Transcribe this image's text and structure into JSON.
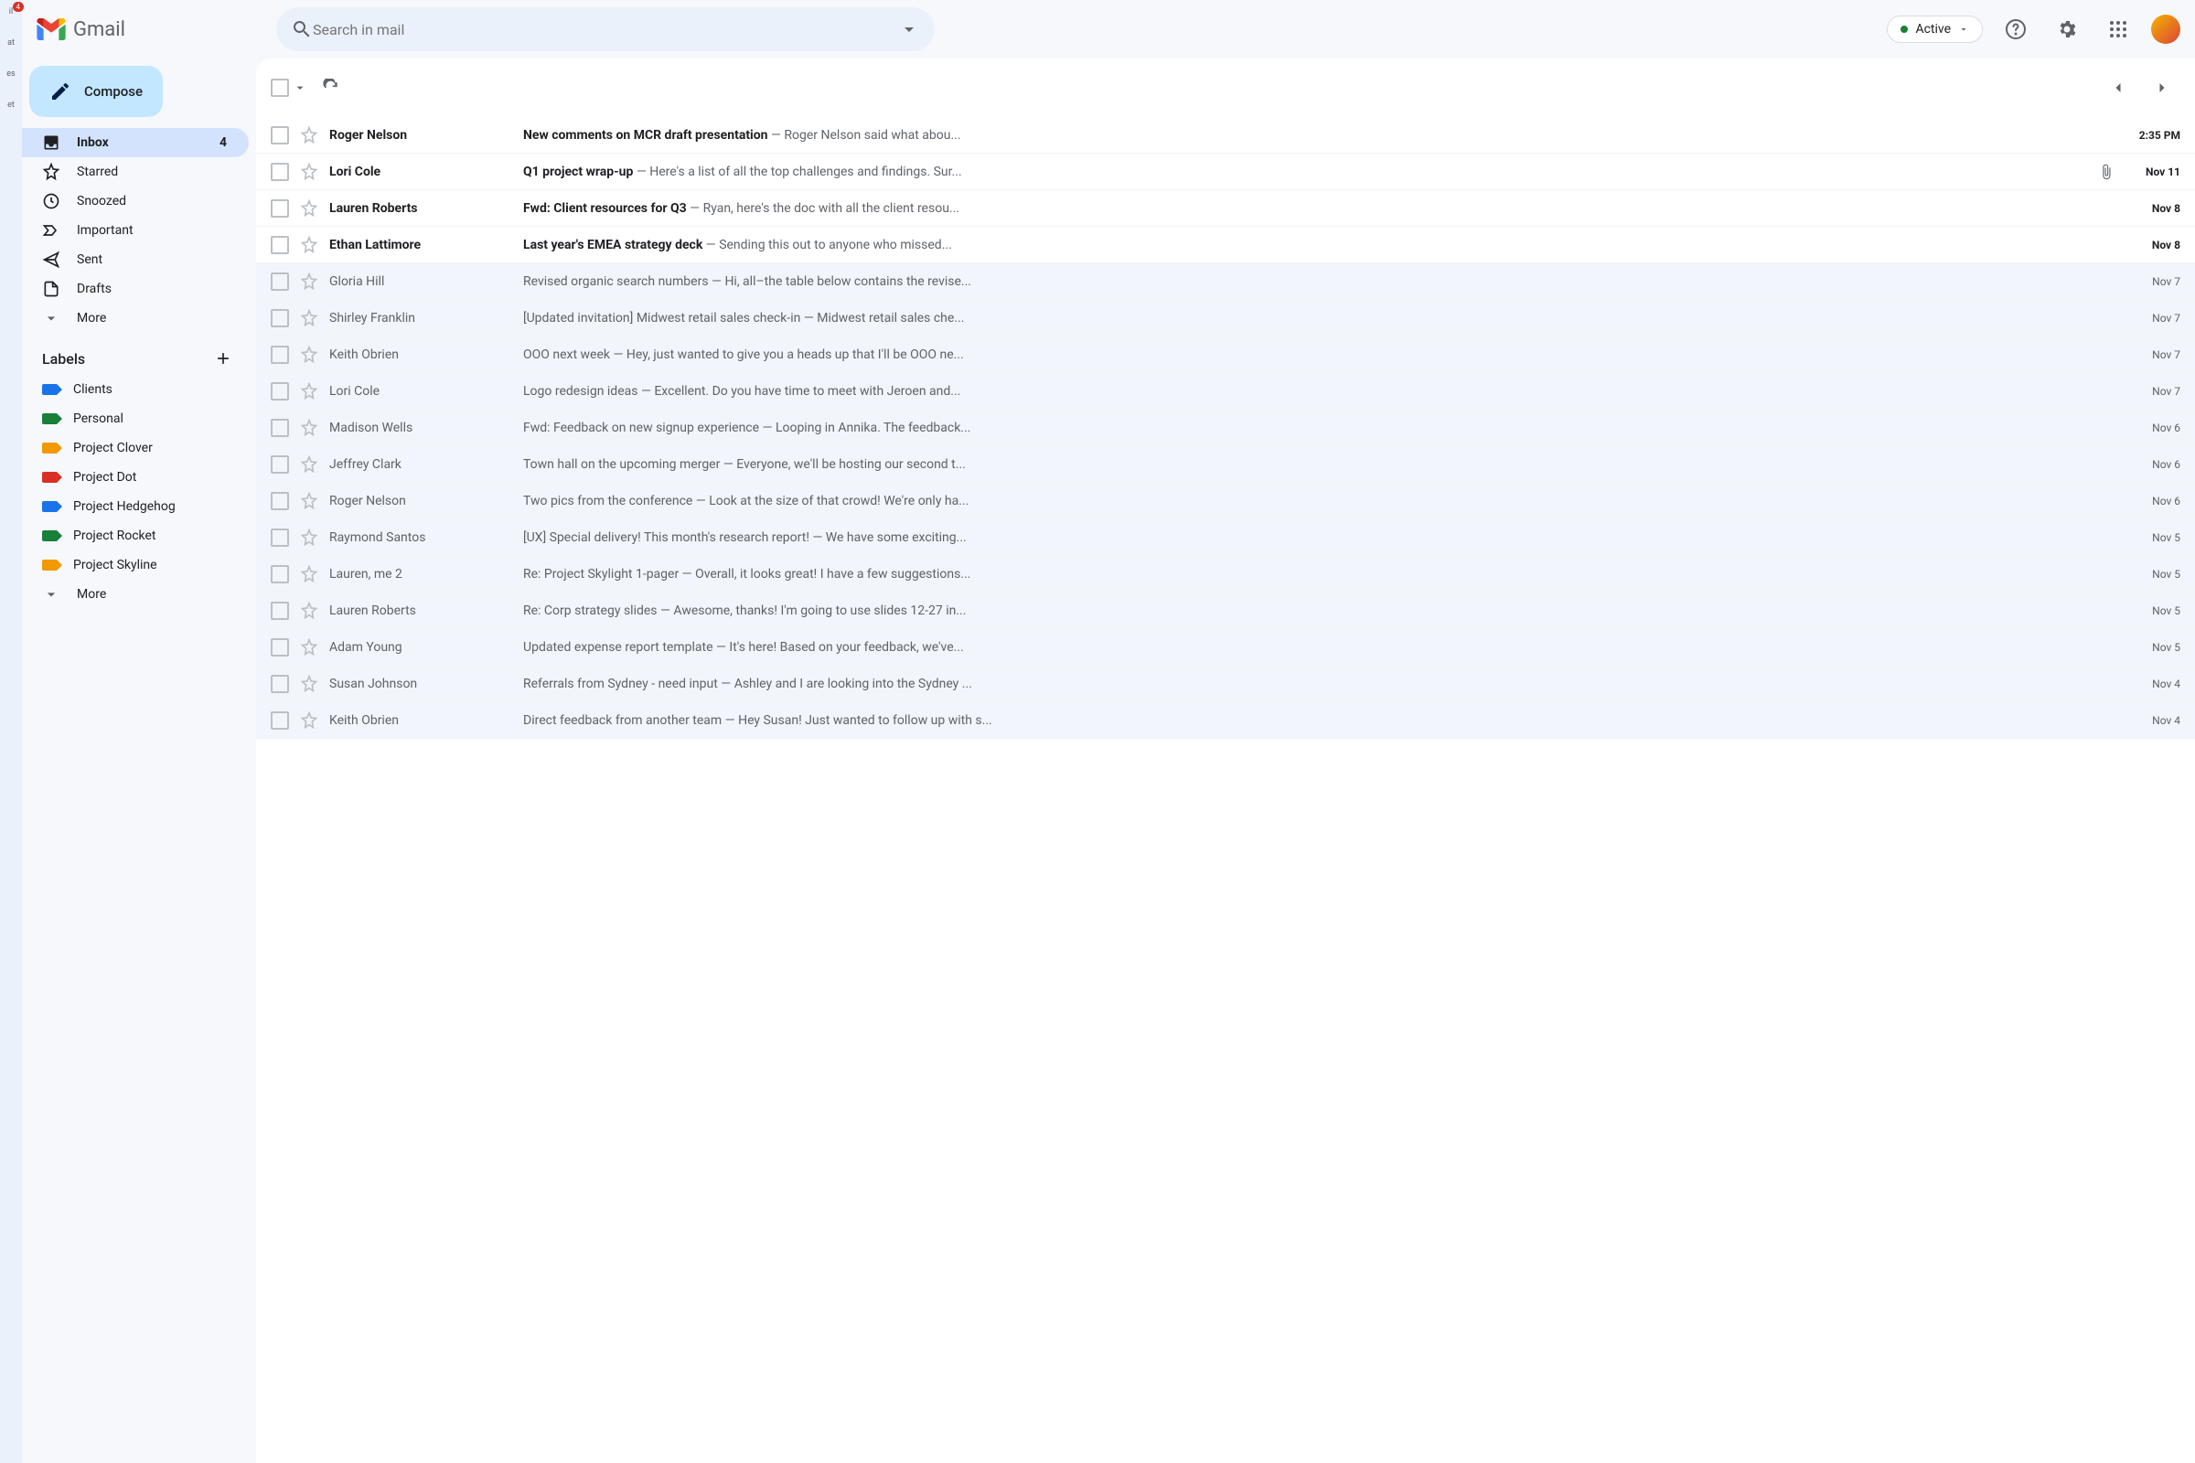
{
  "app_name": "Gmail",
  "search": {
    "placeholder": "Search in mail"
  },
  "status": {
    "label": "Active"
  },
  "compose_label": "Compose",
  "nav": [
    {
      "icon": "inbox",
      "label": "Inbox",
      "count": "4",
      "active": true
    },
    {
      "icon": "star",
      "label": "Starred"
    },
    {
      "icon": "clock",
      "label": "Snoozed"
    },
    {
      "icon": "important",
      "label": "Important"
    },
    {
      "icon": "send",
      "label": "Sent"
    },
    {
      "icon": "draft",
      "label": "Drafts"
    },
    {
      "icon": "more",
      "label": "More"
    }
  ],
  "labels_header": "Labels",
  "labels": [
    {
      "color": "#1a73e8",
      "name": "Clients"
    },
    {
      "color": "#188038",
      "name": "Personal"
    },
    {
      "color": "#f29900",
      "name": "Project Clover"
    },
    {
      "color": "#d93025",
      "name": "Project Dot"
    },
    {
      "color": "#1a73e8",
      "name": "Project Hedgehog"
    },
    {
      "color": "#188038",
      "name": "Project Rocket"
    },
    {
      "color": "#f29900",
      "name": "Project Skyline"
    }
  ],
  "labels_more": "More",
  "rail": [
    {
      "label": "il",
      "badge": "4"
    },
    {
      "label": "at"
    },
    {
      "label": "es"
    },
    {
      "label": "et"
    }
  ],
  "messages": [
    {
      "unread": true,
      "sender": "Roger Nelson",
      "subject": "New comments on MCR draft presentation",
      "snippet": "Roger Nelson said what abou...",
      "date": "2:35 PM"
    },
    {
      "unread": true,
      "sender": "Lori Cole",
      "subject": "Q1 project wrap-up",
      "snippet": "Here's a list of all the top challenges and findings. Sur...",
      "attachment": true,
      "date": "Nov 11"
    },
    {
      "unread": true,
      "sender": "Lauren Roberts",
      "subject": "Fwd: Client resources for Q3",
      "snippet": "Ryan, here's the doc with all the client resou...",
      "date": "Nov 8"
    },
    {
      "unread": true,
      "sender": "Ethan Lattimore",
      "subject": "Last year's EMEA strategy deck",
      "snippet": "Sending this out to anyone who missed...",
      "date": "Nov 8"
    },
    {
      "unread": false,
      "sender": "Gloria Hill",
      "subject": "Revised organic search numbers",
      "snippet": "Hi, all–the table below contains the revise...",
      "date": "Nov 7"
    },
    {
      "unread": false,
      "sender": "Shirley Franklin",
      "subject": "[Updated invitation] Midwest retail sales check-in",
      "snippet": "Midwest retail sales che...",
      "date": "Nov 7"
    },
    {
      "unread": false,
      "sender": "Keith Obrien",
      "subject": "OOO next week",
      "snippet": "Hey, just wanted to give you a heads up that I'll be OOO ne...",
      "date": "Nov 7"
    },
    {
      "unread": false,
      "sender": "Lori Cole",
      "subject": "Logo redesign ideas",
      "snippet": "Excellent. Do you have time to meet with Jeroen and...",
      "date": "Nov 7"
    },
    {
      "unread": false,
      "sender": "Madison Wells",
      "subject": "Fwd: Feedback on new signup experience",
      "snippet": "Looping in Annika. The feedback...",
      "date": "Nov 6"
    },
    {
      "unread": false,
      "sender": "Jeffrey Clark",
      "subject": "Town hall on the upcoming merger",
      "snippet": "Everyone, we'll be hosting our second t...",
      "date": "Nov 6"
    },
    {
      "unread": false,
      "sender": "Roger Nelson",
      "subject": "Two pics from the conference",
      "snippet": "Look at the size of that crowd! We're only ha...",
      "date": "Nov 6"
    },
    {
      "unread": false,
      "sender": "Raymond Santos",
      "subject": "[UX] Special delivery! This month's research report!",
      "snippet": "We have some exciting...",
      "date": "Nov 5"
    },
    {
      "unread": false,
      "sender": "Lauren, me  2",
      "subject": "Re: Project Skylight 1-pager",
      "snippet": "Overall, it looks great! I have a few suggestions...",
      "date": "Nov 5"
    },
    {
      "unread": false,
      "sender": "Lauren Roberts",
      "subject": "Re: Corp strategy slides",
      "snippet": "Awesome, thanks! I'm going to use slides 12-27 in...",
      "date": "Nov 5"
    },
    {
      "unread": false,
      "sender": "Adam Young",
      "subject": "Updated expense report template",
      "snippet": "It's here! Based on your feedback, we've...",
      "date": "Nov 5"
    },
    {
      "unread": false,
      "sender": "Susan Johnson",
      "subject": "Referrals from Sydney - need input",
      "snippet": "Ashley and I are looking into the Sydney ...",
      "date": "Nov 4"
    },
    {
      "unread": false,
      "sender": "Keith Obrien",
      "subject": "Direct feedback from another team",
      "snippet": "Hey Susan! Just wanted to follow up with s...",
      "date": "Nov 4"
    }
  ]
}
